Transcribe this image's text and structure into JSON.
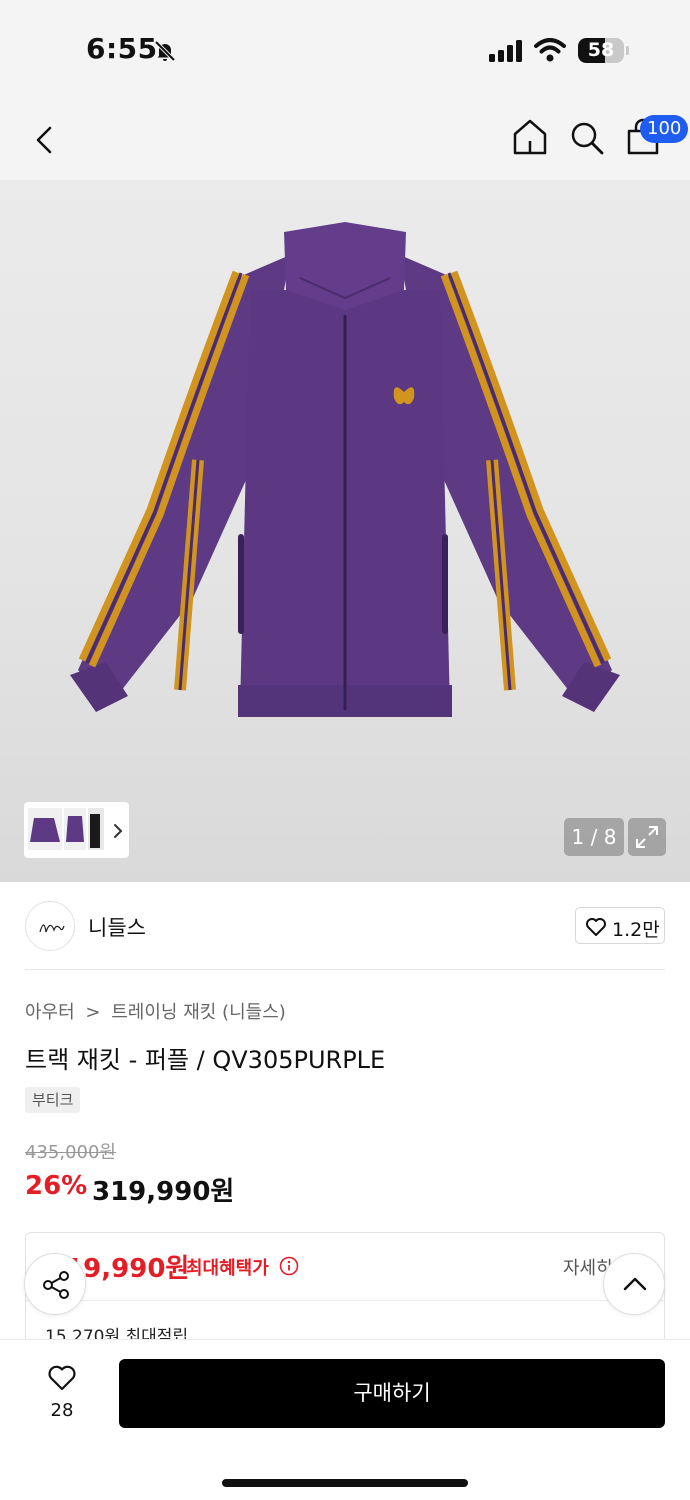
{
  "status_bar": {
    "time": "6:55",
    "battery": "58",
    "battery_level_percent": 58
  },
  "header": {
    "cart_badge": "100"
  },
  "gallery": {
    "counter": "1 / 8"
  },
  "brand": {
    "name": "니들스",
    "likes": "1.2만"
  },
  "product": {
    "breadcrumb": [
      "아우터",
      "트레이닝 재킷 (니들스)"
    ],
    "breadcrumb_separator": ">",
    "title": "트랙 재킷 - 퍼플 / QV305PURPLE",
    "tag": "부티크",
    "original_price": "435,000원",
    "discount": "26%",
    "sale_price": "319,990원"
  },
  "benefit": {
    "price": "319,990원",
    "label": "최대혜택가",
    "detail_label": "자세히",
    "points": "15,270원 최대적립"
  },
  "bottom_bar": {
    "wish_count": "28",
    "buy_label": "구매하기"
  },
  "colors": {
    "accent_red": "#e41e26",
    "badge_blue": "#1e5cf2",
    "jacket_purple": "#5e3a84",
    "stripe_gold": "#d1941f"
  }
}
